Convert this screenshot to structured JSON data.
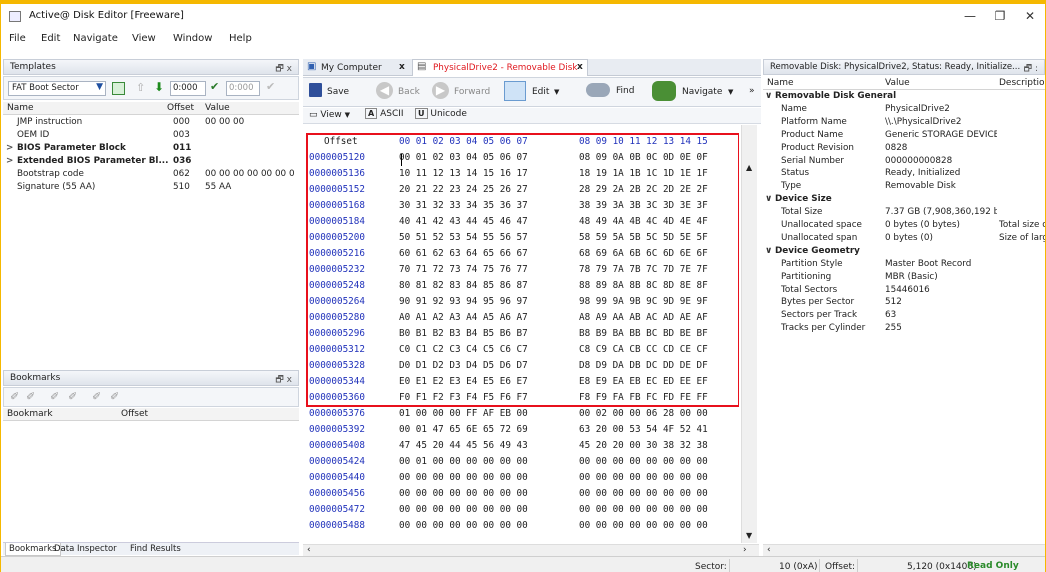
{
  "window": {
    "title": "Active@ Disk Editor [Freeware]",
    "minimize": "—",
    "restore": "❐",
    "close": "✕"
  },
  "menu": [
    "File",
    "Edit",
    "Navigate",
    "View",
    "Window",
    "Help"
  ],
  "templates": {
    "title": "Templates",
    "pin": "🗗 x",
    "combo_value": "FAT Boot Sector",
    "offset_a": "0:000",
    "offset_b": "0:000",
    "columns": {
      "name": "Name",
      "offset": "Offset",
      "value": "Value"
    },
    "rows": [
      {
        "name": "JMP instruction",
        "offset": "000",
        "value": "00 00 00",
        "bold": false,
        "expander": ""
      },
      {
        "name": "OEM ID",
        "offset": "003",
        "value": "",
        "bold": false,
        "expander": ""
      },
      {
        "name": "BIOS Parameter Block",
        "offset": "011",
        "value": "",
        "bold": true,
        "expander": ">"
      },
      {
        "name": "Extended BIOS Parameter Bl...",
        "offset": "036",
        "value": "",
        "bold": true,
        "expander": ">"
      },
      {
        "name": "Bootstrap code",
        "offset": "062",
        "value": "00 00 00 00 00 00 00 ...",
        "bold": false,
        "expander": ""
      },
      {
        "name": "Signature (55 AA)",
        "offset": "510",
        "value": "55 AA",
        "bold": false,
        "expander": ""
      }
    ]
  },
  "bookmarks": {
    "title": "Bookmarks",
    "pin": "🗗 x",
    "columns": {
      "bookmark": "Bookmark",
      "offset": "Offset"
    }
  },
  "left_tabs": [
    "Bookmarks",
    "Data Inspector",
    "Find Results"
  ],
  "doc_tabs": [
    {
      "label": "My Computer",
      "close": "x",
      "active": false
    },
    {
      "label": "PhysicalDrive2 - Removable Disk",
      "close": "x",
      "active": true
    }
  ],
  "toolbar": {
    "save": "Save",
    "back": "Back",
    "forward": "Forward",
    "edit": "Edit",
    "find": "Find",
    "navigate": "Navigate",
    "more": "»"
  },
  "viewbar": {
    "view": "View",
    "ascii": "ASCII",
    "unicode": "Unicode"
  },
  "hex": {
    "offset_header": "Offset",
    "col_header_a": "00 01 02 03 04 05 06 07",
    "col_header_b": "08 09 10 11 12 13 14 15",
    "rows": [
      {
        "addr": "0000005120",
        "a": "00 01 02 03 04 05 06 07",
        "b": "08 09 0A 0B 0C 0D 0E 0F"
      },
      {
        "addr": "0000005136",
        "a": "10 11 12 13 14 15 16 17",
        "b": "18 19 1A 1B 1C 1D 1E 1F"
      },
      {
        "addr": "0000005152",
        "a": "20 21 22 23 24 25 26 27",
        "b": "28 29 2A 2B 2C 2D 2E 2F"
      },
      {
        "addr": "0000005168",
        "a": "30 31 32 33 34 35 36 37",
        "b": "38 39 3A 3B 3C 3D 3E 3F"
      },
      {
        "addr": "0000005184",
        "a": "40 41 42 43 44 45 46 47",
        "b": "48 49 4A 4B 4C 4D 4E 4F"
      },
      {
        "addr": "0000005200",
        "a": "50 51 52 53 54 55 56 57",
        "b": "58 59 5A 5B 5C 5D 5E 5F"
      },
      {
        "addr": "0000005216",
        "a": "60 61 62 63 64 65 66 67",
        "b": "68 69 6A 6B 6C 6D 6E 6F"
      },
      {
        "addr": "0000005232",
        "a": "70 71 72 73 74 75 76 77",
        "b": "78 79 7A 7B 7C 7D 7E 7F"
      },
      {
        "addr": "0000005248",
        "a": "80 81 82 83 84 85 86 87",
        "b": "88 89 8A 8B 8C 8D 8E 8F"
      },
      {
        "addr": "0000005264",
        "a": "90 91 92 93 94 95 96 97",
        "b": "98 99 9A 9B 9C 9D 9E 9F"
      },
      {
        "addr": "0000005280",
        "a": "A0 A1 A2 A3 A4 A5 A6 A7",
        "b": "A8 A9 AA AB AC AD AE AF"
      },
      {
        "addr": "0000005296",
        "a": "B0 B1 B2 B3 B4 B5 B6 B7",
        "b": "B8 B9 BA BB BC BD BE BF"
      },
      {
        "addr": "0000005312",
        "a": "C0 C1 C2 C3 C4 C5 C6 C7",
        "b": "C8 C9 CA CB CC CD CE CF"
      },
      {
        "addr": "0000005328",
        "a": "D0 D1 D2 D3 D4 D5 D6 D7",
        "b": "D8 D9 DA DB DC DD DE DF"
      },
      {
        "addr": "0000005344",
        "a": "E0 E1 E2 E3 E4 E5 E6 E7",
        "b": "E8 E9 EA EB EC ED EE EF"
      },
      {
        "addr": "0000005360",
        "a": "F0 F1 F2 F3 F4 F5 F6 F7",
        "b": "F8 F9 FA FB FC FD FE FF"
      },
      {
        "addr": "0000005376",
        "a": "01 00 00 00 FF AF EB 00",
        "b": "00 02 00 00 06 28 00 00"
      },
      {
        "addr": "0000005392",
        "a": "00 01 47 65 6E 65 72 69",
        "b": "63 20 00 53 54 4F 52 41"
      },
      {
        "addr": "0000005408",
        "a": "47 45 20 44 45 56 49 43",
        "b": "45 20 20 00 30 38 32 38"
      },
      {
        "addr": "0000005424",
        "a": "00 01 00 00 00 00 00 00",
        "b": "00 00 00 00 00 00 00 00"
      },
      {
        "addr": "0000005440",
        "a": "00 00 00 00 00 00 00 00",
        "b": "00 00 00 00 00 00 00 00"
      },
      {
        "addr": "0000005456",
        "a": "00 00 00 00 00 00 00 00",
        "b": "00 00 00 00 00 00 00 00"
      },
      {
        "addr": "0000005472",
        "a": "00 00 00 00 00 00 00 00",
        "b": "00 00 00 00 00 00 00 00"
      },
      {
        "addr": "0000005488",
        "a": "00 00 00 00 00 00 00 00",
        "b": "00 00 00 00 00 00 00 00"
      }
    ]
  },
  "properties": {
    "title": "Removable Disk: PhysicalDrive2, Status: Ready, Initialize...",
    "pin": "🗗 :",
    "columns": {
      "name": "Name",
      "value": "Value",
      "desc": "Description"
    },
    "groups": [
      {
        "label": "Removable Disk General",
        "rows": [
          {
            "name": "Name",
            "value": "PhysicalDrive2",
            "desc": ""
          },
          {
            "name": "Platform Name",
            "value": "\\\\.\\PhysicalDrive2",
            "desc": ""
          },
          {
            "name": "Product Name",
            "value": "Generic STORAGE DEVICE ...",
            "desc": ""
          },
          {
            "name": "Product Revision",
            "value": "0828",
            "desc": ""
          },
          {
            "name": "Serial Number",
            "value": "000000000828",
            "desc": ""
          },
          {
            "name": "Status",
            "value": "Ready, Initialized",
            "desc": ""
          },
          {
            "name": "Type",
            "value": "Removable Disk",
            "desc": ""
          }
        ]
      },
      {
        "label": "Device Size",
        "rows": [
          {
            "name": "Total Size",
            "value": "7.37 GB (7,908,360,192 byt...",
            "desc": ""
          },
          {
            "name": "Unallocated space",
            "value": "0 bytes (0 bytes)",
            "desc": "Total size o"
          },
          {
            "name": "Unallocated span",
            "value": "0 bytes (0)",
            "desc": "Size of larg"
          }
        ]
      },
      {
        "label": "Device Geometry",
        "rows": [
          {
            "name": "Partition Style",
            "value": "Master Boot Record",
            "desc": ""
          },
          {
            "name": "Partitioning",
            "value": "MBR (Basic)",
            "desc": ""
          },
          {
            "name": "Total Sectors",
            "value": "15446016",
            "desc": ""
          },
          {
            "name": "Bytes per Sector",
            "value": "512",
            "desc": ""
          },
          {
            "name": "Sectors per Track",
            "value": "63",
            "desc": ""
          },
          {
            "name": "Tracks per Cylinder",
            "value": "255",
            "desc": ""
          }
        ]
      }
    ]
  },
  "status": {
    "sector_label": "Sector:",
    "sector_value": "10 (0xA)",
    "offset_label": "Offset:",
    "offset_value": "5,120 (0x1400)",
    "mode": "Read Only"
  },
  "colors": {
    "accent_border": "#f5b800",
    "selection": "#e8101c",
    "addr": "#2233bb",
    "readonly": "#2a8a2a"
  }
}
